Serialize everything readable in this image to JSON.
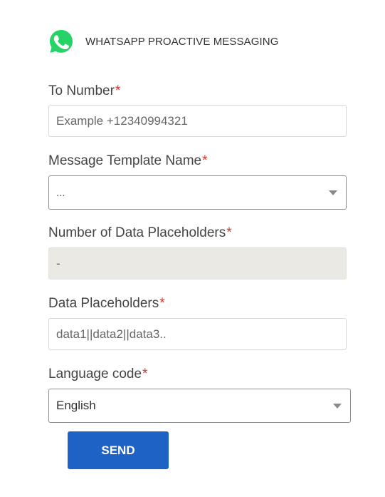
{
  "header": {
    "icon": "whatsapp-icon",
    "title": "WHATSAPP PROACTIVE MESSAGING",
    "brand_color": "#25d366"
  },
  "form": {
    "to_number": {
      "label": "To Number",
      "required_mark": "*",
      "placeholder": "Example +12340994321",
      "value": ""
    },
    "message_template": {
      "label": "Message Template Name",
      "required_mark": "*",
      "selected": "...",
      "icon": "chevron-down-icon"
    },
    "num_placeholders": {
      "label": "Number of Data Placeholders",
      "required_mark": "*",
      "value": "-"
    },
    "data_placeholders": {
      "label": "Data Placeholders",
      "required_mark": "*",
      "placeholder": "data1||data2||data3..",
      "value": ""
    },
    "language_code": {
      "label": "Language code",
      "required_mark": "*",
      "selected": "English",
      "icon": "chevron-down-icon"
    }
  },
  "actions": {
    "send_label": "SEND",
    "send_color": "#1e62c6"
  },
  "colors": {
    "required": "#d9342b",
    "readonly_bg": "#eae9e4"
  }
}
